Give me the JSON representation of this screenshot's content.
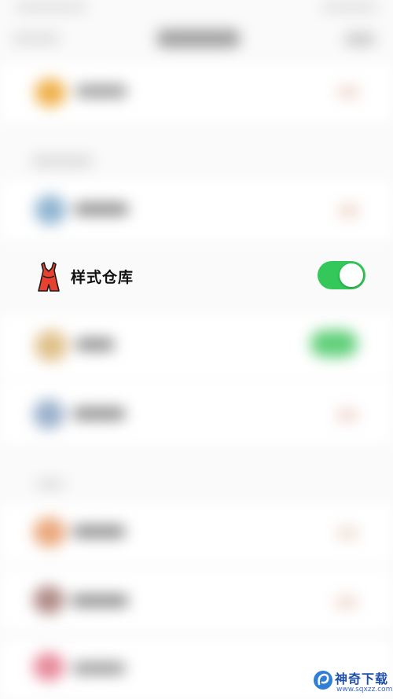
{
  "settings": {
    "focused_item": {
      "label": "样式仓库",
      "icon": "dress-icon",
      "toggle_on": true
    }
  },
  "colors": {
    "toggle_on": "#34c759",
    "dress_red": "#e8412f",
    "background": "#fafafa"
  },
  "watermark": {
    "title": "神奇下载",
    "url": "www.sqxzz.com"
  }
}
